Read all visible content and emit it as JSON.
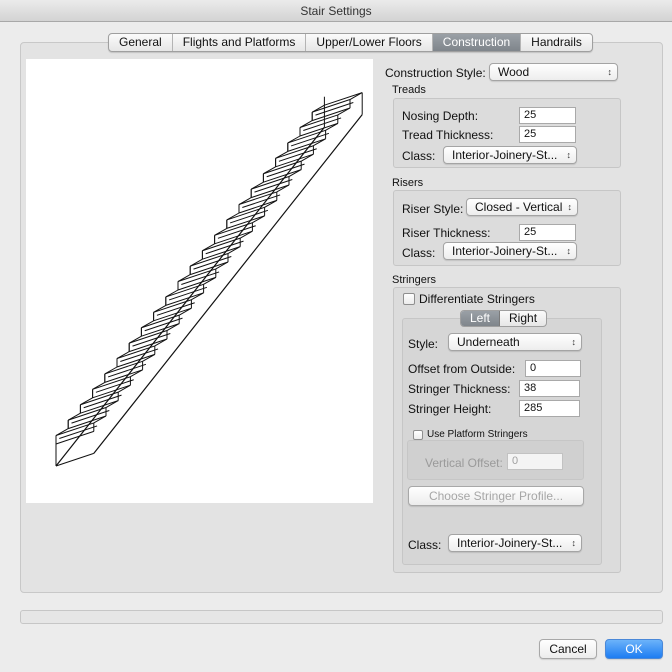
{
  "window": {
    "title": "Stair Settings"
  },
  "tabs": [
    {
      "label": "General"
    },
    {
      "label": "Flights and Platforms"
    },
    {
      "label": "Upper/Lower Floors"
    },
    {
      "label": "Construction"
    },
    {
      "label": "Handrails"
    }
  ],
  "active_tab": "Construction",
  "construction": {
    "style_label": "Construction Style:",
    "style_value": "Wood",
    "treads": {
      "heading": "Treads",
      "nosing_depth_label": "Nosing Depth:",
      "nosing_depth": "25",
      "tread_thickness_label": "Tread Thickness:",
      "tread_thickness": "25",
      "class_label": "Class:",
      "class_value": "Interior-Joinery-St..."
    },
    "risers": {
      "heading": "Risers",
      "riser_style_label": "Riser Style:",
      "riser_style": "Closed - Vertical",
      "riser_thickness_label": "Riser Thickness:",
      "riser_thickness": "25",
      "class_label": "Class:",
      "class_value": "Interior-Joinery-St..."
    },
    "stringers": {
      "heading": "Stringers",
      "differentiate_label": "Differentiate Stringers",
      "differentiate_checked": false,
      "left_label": "Left",
      "right_label": "Right",
      "style_label": "Style:",
      "style_value": "Underneath",
      "offset_label": "Offset from Outside:",
      "offset_value": "0",
      "thickness_label": "Stringer Thickness:",
      "thickness_value": "38",
      "height_label": "Stringer Height:",
      "height_value": "285",
      "use_platform_label": "Use Platform Stringers",
      "use_platform_checked": false,
      "vertical_offset_label": "Vertical Offset:",
      "vertical_offset_value": "0",
      "choose_profile_label": "Choose Stringer Profile...",
      "class_label": "Class:",
      "class_value": "Interior-Joinery-St..."
    }
  },
  "buttons": {
    "cancel": "Cancel",
    "ok": "OK"
  },
  "icons": {
    "popup_arrows": "↕"
  },
  "colors": {
    "accent": "#1d7cf2",
    "active_tab": "#8a9096"
  }
}
